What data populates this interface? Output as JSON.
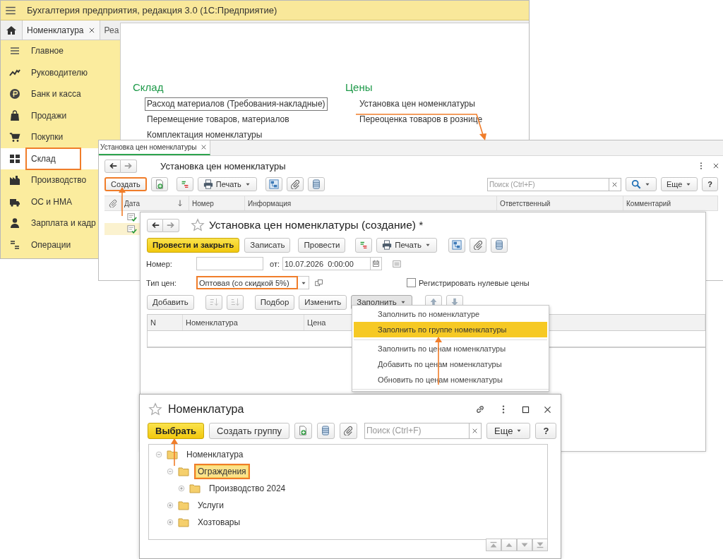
{
  "app_window": {
    "title": "Бухгалтерия предприятия, редакция 3.0  (1С:Предприятие)",
    "tabs": [
      {
        "label": "Номенклатура",
        "closable": true,
        "selected": true
      },
      {
        "label": "Реа",
        "closable": false,
        "selected": false
      }
    ],
    "sidebar": {
      "items": [
        {
          "label": "Главное",
          "selected": false,
          "annotated": false
        },
        {
          "label": "Руководителю",
          "selected": false,
          "annotated": false
        },
        {
          "label": "Банк и касса",
          "selected": false,
          "annotated": false
        },
        {
          "label": "Продажи",
          "selected": false,
          "annotated": false
        },
        {
          "label": "Покупки",
          "selected": false,
          "annotated": false
        },
        {
          "label": "Склад",
          "selected": true,
          "annotated": true
        },
        {
          "label": "Производство",
          "selected": false,
          "annotated": false
        },
        {
          "label": "ОС и НМА",
          "selected": false,
          "annotated": false
        },
        {
          "label": "Зарплата и кадр",
          "selected": false,
          "annotated": false
        },
        {
          "label": "Операции",
          "selected": false,
          "annotated": false
        }
      ]
    },
    "sections": [
      {
        "title": "Склад",
        "links": [
          {
            "label": "Расход материалов (Требования-накладные)",
            "focused": true
          },
          {
            "label": "Перемещение товаров, материалов",
            "focused": false
          },
          {
            "label": "Комплектация номенклатуры",
            "focused": false
          }
        ]
      },
      {
        "title": "Цены",
        "links": [
          {
            "label": "Установка цен номенклатуры",
            "focused": false
          },
          {
            "label": "Переоценка товаров в рознице",
            "focused": false
          }
        ]
      }
    ]
  },
  "list_window": {
    "tab": {
      "label": "Установка цен номенклатуры",
      "selected": true
    },
    "title": "Установка цен номенклатуры",
    "toolbar": {
      "create_button": {
        "label": "Создать",
        "annotated": true
      },
      "print_button": "Печать",
      "search_placeholder": "Поиск (Ctrl+F)",
      "more_button": "Еще",
      "help_button": "?"
    },
    "columns": [
      "Дата",
      "Номер",
      "Информация",
      "Ответственный",
      "Комментарий"
    ],
    "rows": [
      {
        "selected": false
      },
      {
        "selected": true
      }
    ]
  },
  "doc_window": {
    "title": "Установка цен номенклатуры (создание) *",
    "buttons": [
      {
        "label": "Провести и закрыть",
        "kind": "primary"
      },
      {
        "label": "Записать",
        "kind": "default"
      },
      {
        "label": "Провести",
        "kind": "default"
      }
    ],
    "print_button": "Печать",
    "number": {
      "label": "Номер:"
    },
    "date": {
      "label": "от:",
      "value": "10.07.2026  0:00:00"
    },
    "price_type": {
      "label": "Тип цен:",
      "value": "Оптовая (со скидкой 5%)",
      "annotated": true
    },
    "register_zero": {
      "label": "Регистрировать нулевые цены",
      "checked": false
    },
    "table_toolbar": {
      "add": "Добавить",
      "pick": "Подбор",
      "edit": "Изменить",
      "fill": "Заполнить"
    },
    "columns": [
      "N",
      "Номенклатура",
      "Цена"
    ]
  },
  "fill_menu": {
    "items": [
      {
        "label": "Заполнить по номенклатуре",
        "selected": false,
        "separator_before": false
      },
      {
        "label": "Заполнить по группе номенклатуры",
        "selected": true,
        "separator_before": false
      },
      {
        "label": "Заполнить по ценам номенклатуры",
        "selected": false,
        "separator_before": true
      },
      {
        "label": "Добавить по ценам номенклатуры",
        "selected": false,
        "separator_before": false
      },
      {
        "label": "Обновить по ценам номенклатуры",
        "selected": false,
        "separator_before": false
      }
    ]
  },
  "picker_window": {
    "title": "Номенклатура",
    "choose_button": "Выбрать",
    "create_group_button": "Создать группу",
    "search_placeholder": "Поиск (Ctrl+F)",
    "more_button": "Еще",
    "help_button": "?",
    "tree": [
      {
        "label": "Номенклатура",
        "expanded": true,
        "selected": false,
        "children": [
          {
            "label": "Ограждения",
            "expanded": true,
            "selected": true,
            "children": [
              {
                "label": "Производство 2024",
                "expanded": false,
                "selected": false
              }
            ]
          },
          {
            "label": "Услуги",
            "expanded": false,
            "selected": false
          },
          {
            "label": "Хозтовары",
            "expanded": false,
            "selected": false
          }
        ]
      }
    ]
  }
}
